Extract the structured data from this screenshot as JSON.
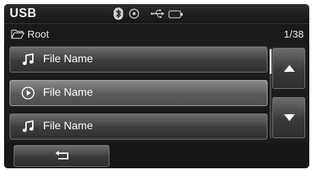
{
  "header": {
    "title": "USB",
    "icons": [
      "bluetooth-icon",
      "disc-icon",
      "usb-icon",
      "battery-icon"
    ]
  },
  "path": {
    "folder_icon": "folder-icon",
    "label": "Root",
    "page_count": "1/38"
  },
  "files": [
    {
      "label": "File Name",
      "icon": "music-note-icon",
      "selected": false
    },
    {
      "label": "File Name",
      "icon": "play-circle-icon",
      "selected": true
    },
    {
      "label": "File Name",
      "icon": "music-note-icon",
      "selected": false
    }
  ],
  "scroll": {
    "up_icon": "arrow-up-icon",
    "down_icon": "arrow-down-icon",
    "position": 0.0
  },
  "footer": {
    "back_icon": "back-arrow-icon"
  },
  "colors": {
    "background": "#1c1c1c",
    "text": "#ffffff",
    "button": "#4a4a4a"
  }
}
